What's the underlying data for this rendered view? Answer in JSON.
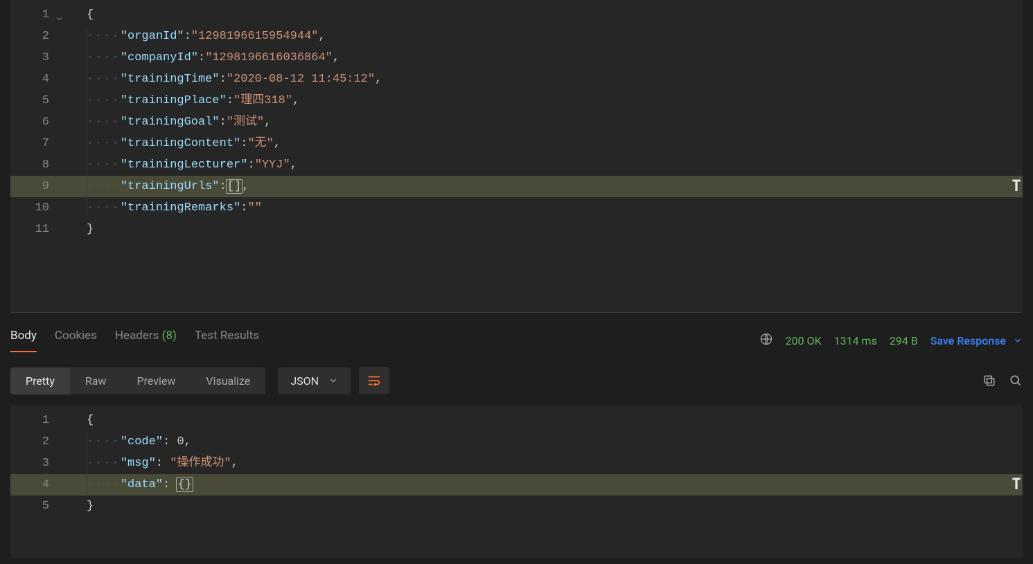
{
  "request_editor": {
    "lines": [
      {
        "n": 1,
        "indent": 0,
        "fold": true,
        "tokens": [
          {
            "t": "punct",
            "v": "{"
          }
        ]
      },
      {
        "n": 2,
        "indent": 1,
        "tokens": [
          {
            "t": "key",
            "v": "\"organId\""
          },
          {
            "t": "punct",
            "v": ":"
          },
          {
            "t": "str",
            "v": "\"1298196615954944\""
          },
          {
            "t": "punct",
            "v": ","
          }
        ]
      },
      {
        "n": 3,
        "indent": 1,
        "tokens": [
          {
            "t": "key",
            "v": "\"companyId\""
          },
          {
            "t": "punct",
            "v": ":"
          },
          {
            "t": "str",
            "v": "\"1298196616036864\""
          },
          {
            "t": "punct",
            "v": ","
          }
        ]
      },
      {
        "n": 4,
        "indent": 1,
        "tokens": [
          {
            "t": "key",
            "v": "\"trainingTime\""
          },
          {
            "t": "punct",
            "v": ":"
          },
          {
            "t": "str",
            "v": "\"2020-08-12 11:45:12\""
          },
          {
            "t": "punct",
            "v": ","
          }
        ]
      },
      {
        "n": 5,
        "indent": 1,
        "tokens": [
          {
            "t": "key",
            "v": "\"trainingPlace\""
          },
          {
            "t": "punct",
            "v": ":"
          },
          {
            "t": "str",
            "v": "\"理四318\""
          },
          {
            "t": "punct",
            "v": ","
          }
        ]
      },
      {
        "n": 6,
        "indent": 1,
        "tokens": [
          {
            "t": "key",
            "v": "\"trainingGoal\""
          },
          {
            "t": "punct",
            "v": ":"
          },
          {
            "t": "str",
            "v": "\"测试\""
          },
          {
            "t": "punct",
            "v": ","
          }
        ]
      },
      {
        "n": 7,
        "indent": 1,
        "tokens": [
          {
            "t": "key",
            "v": "\"trainingContent\""
          },
          {
            "t": "punct",
            "v": ":"
          },
          {
            "t": "str",
            "v": "\"无\""
          },
          {
            "t": "punct",
            "v": ","
          }
        ]
      },
      {
        "n": 8,
        "indent": 1,
        "tokens": [
          {
            "t": "key",
            "v": "\"trainingLecturer\""
          },
          {
            "t": "punct",
            "v": ":"
          },
          {
            "t": "str",
            "v": "\"YYJ\""
          },
          {
            "t": "punct",
            "v": ","
          }
        ]
      },
      {
        "n": 9,
        "indent": 1,
        "highlight": true,
        "overflow": true,
        "tokens": [
          {
            "t": "key",
            "v": "\"trainingUrls\""
          },
          {
            "t": "punct",
            "v": ":"
          },
          {
            "t": "punct",
            "v": "[]",
            "boxed": true
          },
          {
            "t": "punct",
            "v": ","
          }
        ]
      },
      {
        "n": 10,
        "indent": 1,
        "tokens": [
          {
            "t": "key",
            "v": "\"trainingRemarks\""
          },
          {
            "t": "punct",
            "v": ":"
          },
          {
            "t": "str",
            "v": "\"\""
          }
        ]
      },
      {
        "n": 11,
        "indent": 0,
        "tokens": [
          {
            "t": "punct",
            "v": "}"
          }
        ]
      }
    ]
  },
  "response_tabs": {
    "body": "Body",
    "cookies": "Cookies",
    "headers": "Headers",
    "headers_count": "(8)",
    "test_results": "Test Results"
  },
  "response_meta": {
    "status": "200 OK",
    "time": "1314 ms",
    "size": "294 B",
    "save_label": "Save Response"
  },
  "view_modes": {
    "pretty": "Pretty",
    "raw": "Raw",
    "preview": "Preview",
    "visualize": "Visualize",
    "format": "JSON"
  },
  "response_editor": {
    "lines": [
      {
        "n": 1,
        "indent": 0,
        "tokens": [
          {
            "t": "punct",
            "v": "{"
          }
        ]
      },
      {
        "n": 2,
        "indent": 1,
        "tokens": [
          {
            "t": "key",
            "v": "\"code\""
          },
          {
            "t": "punct",
            "v": ": "
          },
          {
            "t": "num",
            "v": "0"
          },
          {
            "t": "punct",
            "v": ","
          }
        ]
      },
      {
        "n": 3,
        "indent": 1,
        "tokens": [
          {
            "t": "key",
            "v": "\"msg\""
          },
          {
            "t": "punct",
            "v": ": "
          },
          {
            "t": "str",
            "v": "\"操作成功\""
          },
          {
            "t": "punct",
            "v": ","
          }
        ]
      },
      {
        "n": 4,
        "indent": 1,
        "highlight": true,
        "overflow": true,
        "tokens": [
          {
            "t": "key",
            "v": "\"data\""
          },
          {
            "t": "punct",
            "v": ": "
          },
          {
            "t": "punct",
            "v": "{}",
            "boxed": true
          }
        ]
      },
      {
        "n": 5,
        "indent": 0,
        "tokens": [
          {
            "t": "punct",
            "v": "}"
          }
        ]
      }
    ]
  }
}
